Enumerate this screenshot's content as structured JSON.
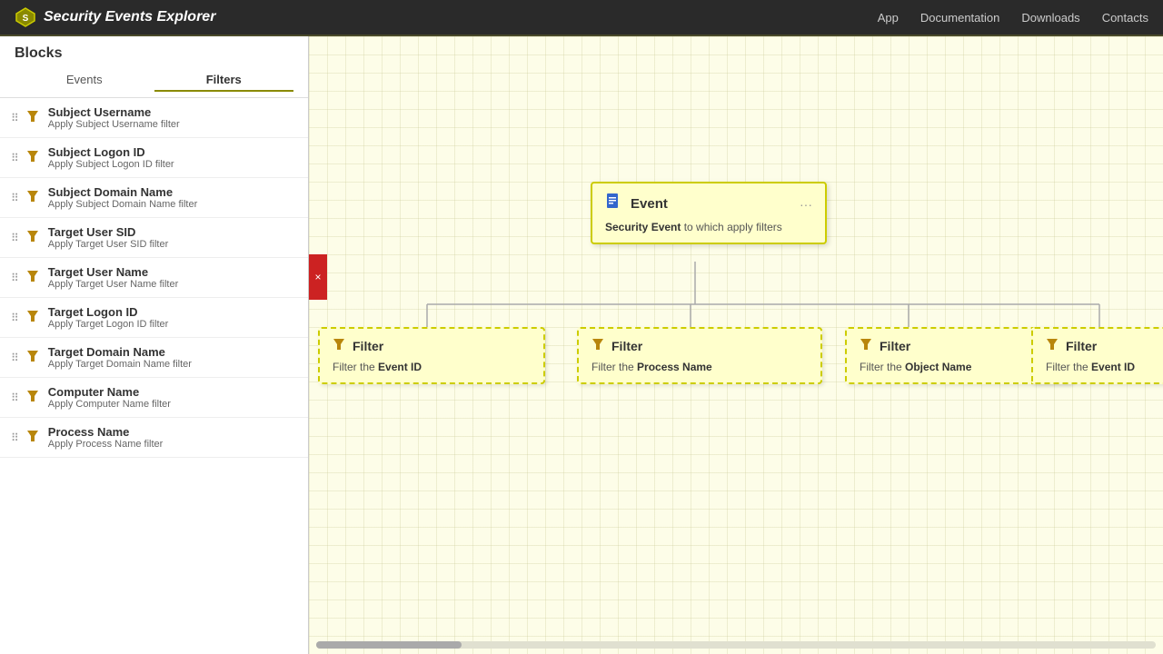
{
  "header": {
    "title": "Security Events Explorer",
    "nav": [
      {
        "label": "App",
        "id": "nav-app"
      },
      {
        "label": "Documentation",
        "id": "nav-docs"
      },
      {
        "label": "Downloads",
        "id": "nav-downloads"
      },
      {
        "label": "Contacts",
        "id": "nav-contacts"
      }
    ]
  },
  "sidebar": {
    "title": "Blocks",
    "tabs": [
      {
        "label": "Events",
        "active": false
      },
      {
        "label": "Filters",
        "active": true
      }
    ],
    "items": [
      {
        "title": "Subject Username",
        "desc": "Apply Subject Username filter"
      },
      {
        "title": "Subject Logon ID",
        "desc": "Apply Subject Logon ID filter"
      },
      {
        "title": "Subject Domain Name",
        "desc": "Apply Subject Domain Name filter"
      },
      {
        "title": "Target User SID",
        "desc": "Apply Target User SID filter"
      },
      {
        "title": "Target User Name",
        "desc": "Apply Target User Name filter"
      },
      {
        "title": "Target Logon ID",
        "desc": "Apply Target Logon ID filter"
      },
      {
        "title": "Target Domain Name",
        "desc": "Apply Target Domain Name filter"
      },
      {
        "title": "Computer Name",
        "desc": "Apply Computer Name filter"
      },
      {
        "title": "Process Name",
        "desc": "Apply Process Name filter"
      }
    ]
  },
  "canvas": {
    "event_block": {
      "title": "Event",
      "description_pre": "Security Event",
      "description_post": " to which apply filters"
    },
    "filter_blocks": [
      {
        "desc_pre": "Filter the ",
        "desc_bold": "Event ID",
        "desc_post": ""
      },
      {
        "desc_pre": "Filter the ",
        "desc_bold": "Process Name",
        "desc_post": ""
      },
      {
        "desc_pre": "Filter the ",
        "desc_bold": "Object Name",
        "desc_post": ""
      },
      {
        "desc_pre": "Filter the ",
        "desc_bold": "Event ID",
        "desc_post": ""
      }
    ]
  },
  "close_button": "×"
}
